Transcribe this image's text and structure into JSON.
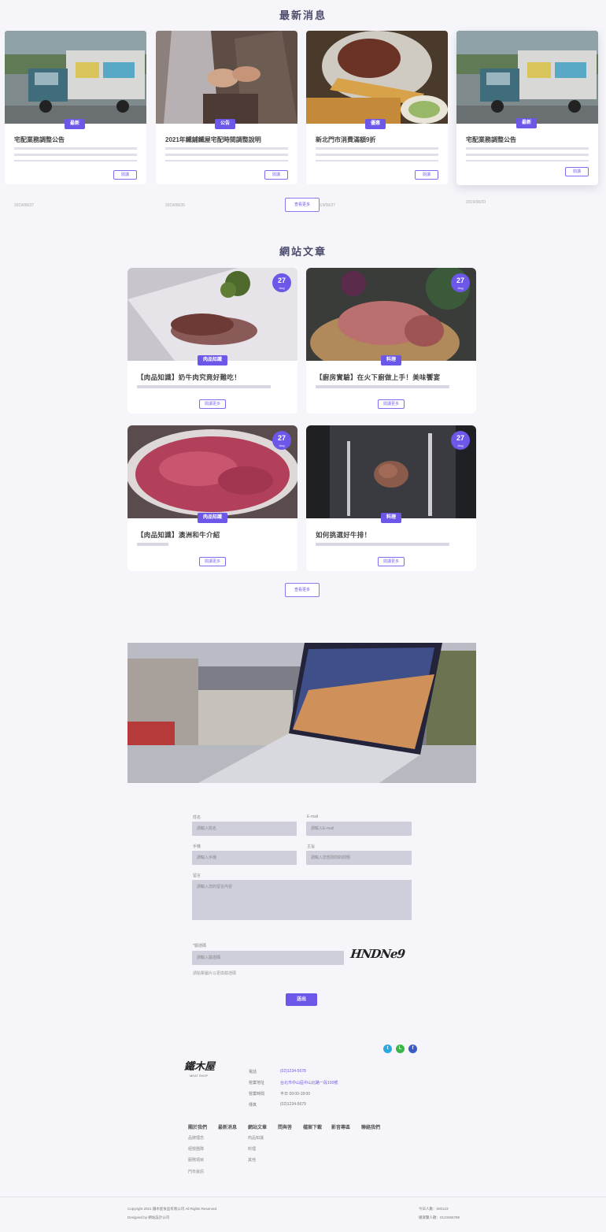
{
  "news": {
    "title": "最新消息",
    "more_label": "查看更多",
    "read_label": "閱讀",
    "items": [
      {
        "title": "宅配業務調整公告",
        "badge": "最新",
        "date": "2019/08/27"
      },
      {
        "title": "2021年鐵鋪鐵屋宅配時間調整說明",
        "badge": "公告",
        "date": "2019/08/25"
      },
      {
        "title": "新北門市消費滿額9折",
        "badge": "優惠",
        "date": "2019/08/27"
      },
      {
        "title": "宅配業務調整公告",
        "badge": "最新",
        "date": "2019/08/20"
      }
    ]
  },
  "articles": {
    "title": "網站文章",
    "more_label": "查看更多",
    "read_label": "閱讀更多",
    "items": [
      {
        "title": "【肉品知識】奶牛肉究竟好難吃！",
        "badge": "肉品知識",
        "day": "27",
        "month": "Aug"
      },
      {
        "title": "【廚房實驗】在火下廚做上手！美味饗宴",
        "badge": "料理",
        "day": "27",
        "month": "Aug"
      },
      {
        "title": "【肉品知識】澳洲和牛介紹",
        "badge": "肉品知識",
        "day": "27",
        "month": "Aug"
      },
      {
        "title": "如何挑選好牛排！",
        "badge": "料理",
        "day": "27",
        "month": "Aug"
      }
    ]
  },
  "form": {
    "name_label": "姓名",
    "name_placeholder": "請輸入姓名",
    "email_label": "E-mail",
    "email_placeholder": "請輸入E-mail",
    "phone_label": "手機",
    "phone_placeholder": "請輸入手機",
    "subject_label": "主旨",
    "subject_placeholder": "請輸入您想詢問的問題",
    "message_label": "留言",
    "message_placeholder": "請輸入您的留言內容",
    "captcha_label": "*驗證碼",
    "captcha_placeholder": "請輸入驗證碼",
    "captcha_hint": "請點擊圖片以更換驗證碼",
    "captcha_text": "HNDNe9",
    "submit_label": "送出"
  },
  "footer": {
    "logo_text": "鐵木屋",
    "logo_sub": "MEAT SHOP",
    "info": [
      {
        "label": "電話",
        "value": "(02)1234-5678",
        "link": true
      },
      {
        "label": "營業地址",
        "value": "台北市中山區中山北路一段100號",
        "link": true
      },
      {
        "label": "營業時間",
        "value": "平日 09:00-18:00",
        "link": false
      },
      {
        "label": "傳真",
        "value": "(02)1234-5679",
        "link": false
      }
    ],
    "nav": [
      "關於我們",
      "最新消息",
      "網站文章",
      "問與答",
      "檔案下載",
      "影音專區",
      "聯絡我們"
    ],
    "about_sub": [
      "品牌理念",
      "經營團隊",
      "服務項目",
      "門市資訊"
    ],
    "articles_sub": [
      "肉品知識",
      "料理",
      "其他"
    ],
    "copyright": "Copyright 2021 鐵木屋食品有限公司 All Rights Reserved.",
    "designer": "Designed by 網站設計公司",
    "visitors_today": "今日人數：000123",
    "visitors_total": "總瀏覽人數：0123456789"
  },
  "colors": {
    "accent": "#6b57e8",
    "background": "#f6f6fa",
    "input": "#cfcfdc"
  }
}
